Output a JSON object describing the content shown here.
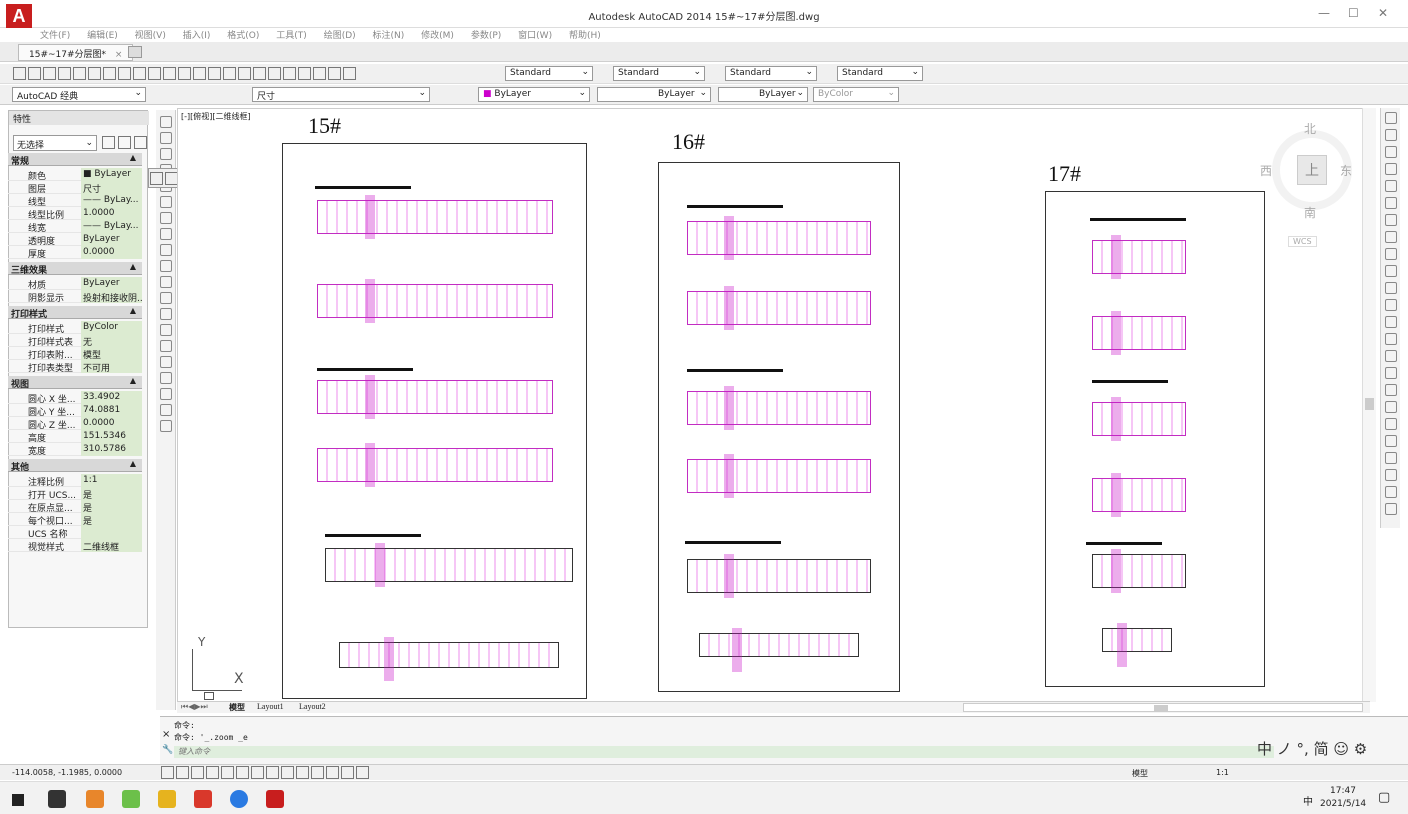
{
  "window": {
    "title": "Autodesk AutoCAD 2014    15#~17#分层图.dwg",
    "logo": "A"
  },
  "menu": [
    "文件(F)",
    "编辑(E)",
    "视图(V)",
    "插入(I)",
    "格式(O)",
    "工具(T)",
    "绘图(D)",
    "标注(N)",
    "修改(M)",
    "参数(P)",
    "窗口(W)",
    "帮助(H)"
  ],
  "doc_tab": {
    "label": "15#~17#分层图*",
    "close": "×"
  },
  "toolbar": {
    "styles": [
      "Standard",
      "Standard",
      "Standard",
      "Standard"
    ],
    "workspace": "AutoCAD 经典",
    "layer": "尺寸",
    "color": "ByLayer",
    "linetype": "ByLayer",
    "lineweight": "ByLayer",
    "plotstyle": "ByColor"
  },
  "properties": {
    "title": "特性",
    "selection": "无选择",
    "sections": [
      {
        "name": "常规",
        "rows": [
          [
            "颜色",
            "■ ByLayer"
          ],
          [
            "图层",
            "尺寸"
          ],
          [
            "线型",
            "—— ByLay..."
          ],
          [
            "线型比例",
            "1.0000"
          ],
          [
            "线宽",
            "—— ByLay..."
          ],
          [
            "透明度",
            "ByLayer"
          ],
          [
            "厚度",
            "0.0000"
          ]
        ]
      },
      {
        "name": "三维效果",
        "rows": [
          [
            "材质",
            "ByLayer"
          ],
          [
            "阴影显示",
            "投射和接收阴..."
          ]
        ]
      },
      {
        "name": "打印样式",
        "rows": [
          [
            "打印样式",
            "ByColor"
          ],
          [
            "打印样式表",
            "无"
          ],
          [
            "打印表附...",
            "模型"
          ],
          [
            "打印表类型",
            "不可用"
          ]
        ]
      },
      {
        "name": "视图",
        "rows": [
          [
            "圆心 X 坐...",
            "33.4902"
          ],
          [
            "圆心 Y 坐...",
            "74.0881"
          ],
          [
            "圆心 Z 坐...",
            "0.0000"
          ],
          [
            "高度",
            "151.5346"
          ],
          [
            "宽度",
            "310.5786"
          ]
        ]
      },
      {
        "name": "其他",
        "rows": [
          [
            "注释比例",
            "1:1"
          ],
          [
            "打开 UCS...",
            "是"
          ],
          [
            "在原点显...",
            "是"
          ],
          [
            "每个视口...",
            "是"
          ],
          [
            "UCS 名称",
            ""
          ],
          [
            "视觉样式",
            "二维线框"
          ]
        ]
      }
    ]
  },
  "viewport": {
    "label": "[-][俯视][二维线框]"
  },
  "buildings": [
    "15#",
    "16#",
    "17#"
  ],
  "viewcube": {
    "north": "北",
    "south": "南",
    "east": "东",
    "west": "西",
    "top": "上",
    "wcs": "WCS"
  },
  "ucs": {
    "x": "X",
    "y": "Y"
  },
  "layout_tabs": [
    "模型",
    "Layout1",
    "Layout2"
  ],
  "command": {
    "lines": [
      "命令:",
      "命令: '_.zoom _e"
    ],
    "prompt": "键入命令"
  },
  "status": {
    "coords": "-114.0058, -1.1985, 0.0000",
    "model": "模型",
    "scale": "1:1"
  },
  "ime": {
    "text": "中 ノ °, 简 ☺ ⚙"
  },
  "taskbar": {
    "time": "17:47",
    "date": "2021/5/14",
    "lang": "中"
  }
}
